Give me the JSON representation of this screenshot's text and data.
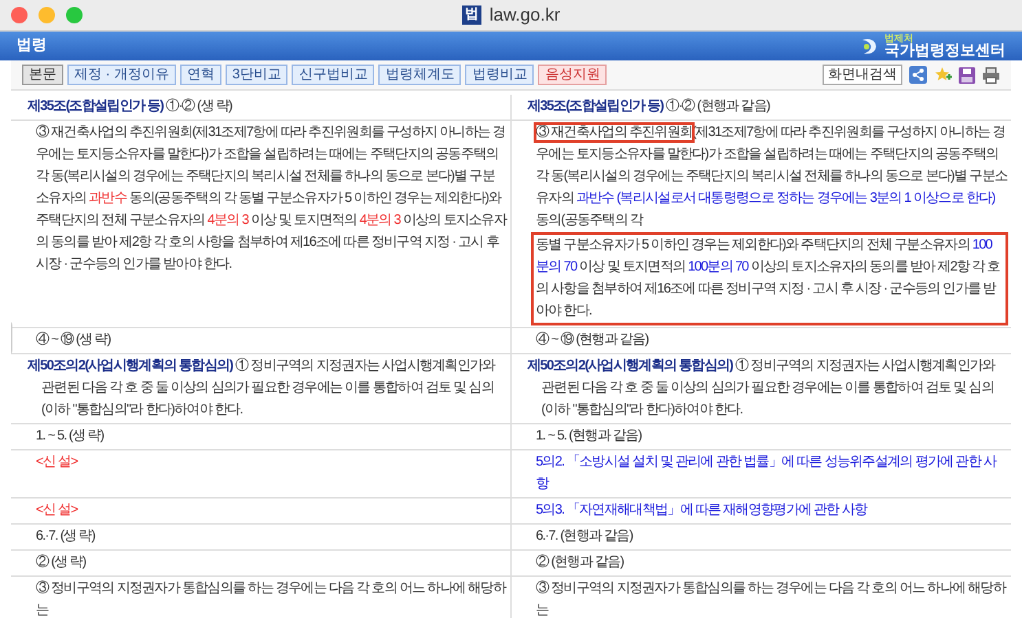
{
  "window": {
    "favicon_text": "법",
    "title": "law.go.kr"
  },
  "header": {
    "title": "법령",
    "logo_small": "법제처",
    "logo_big": "국가법령정보센터"
  },
  "toolbar": {
    "tabs": [
      {
        "label": "본문",
        "kind": "normal",
        "selected": true
      },
      {
        "label": "제정 · 개정이유",
        "kind": "normal",
        "selected": false
      },
      {
        "label": "연혁",
        "kind": "normal",
        "selected": false
      },
      {
        "label": "3단비교",
        "kind": "normal",
        "selected": false
      },
      {
        "label": "신구법비교",
        "kind": "normal",
        "selected": false
      },
      {
        "label": "법령체계도",
        "kind": "normal",
        "selected": false
      },
      {
        "label": "법령비교",
        "kind": "normal",
        "selected": false
      },
      {
        "label": "음성지원",
        "kind": "voice",
        "selected": false
      }
    ],
    "search_button": "화면내검색"
  },
  "rows": [
    {
      "left": {
        "kind": "heading",
        "blocks": [
          {
            "kind": "normal",
            "segments": [
              {
                "kind": "article",
                "text": "제35조(조합설립인가 등)"
              },
              {
                "kind": "plain",
                "text": " ①·② (생 략)"
              }
            ]
          }
        ]
      },
      "right": {
        "kind": "heading",
        "blocks": [
          {
            "kind": "normal",
            "segments": [
              {
                "kind": "article",
                "text": "제35조(조합설립인가 등)"
              },
              {
                "kind": "plain",
                "text": " ①·② (현행과 같음)"
              }
            ]
          }
        ]
      }
    },
    {
      "left": {
        "kind": "body",
        "blocks": [
          {
            "kind": "normal",
            "segments": [
              {
                "kind": "plain",
                "text": "③ 재건축사업의 추진위원회(제31조제7항에 따라 추진위원회를 구성하지 아니하는 경우에는 토지등소유자를 말한다)가 조합을 설립하려는 때에는 주택단지의 공동주택의 각 동(복리시설의 경우에는 주택단지의 복리시설 전체를 하나의 동으로 본다)별 구분소유자의 "
              },
              {
                "kind": "deleted",
                "text": "과반수"
              },
              {
                "kind": "plain",
                "text": " 동의(공동주택의 각 동별 구분소유자가 5 이하인 경우는 제외한다)와 주택단지의 전체 구분소유자의 "
              },
              {
                "kind": "deleted",
                "text": "4분의 3"
              },
              {
                "kind": "plain",
                "text": " 이상 및 토지면적의 "
              },
              {
                "kind": "deleted",
                "text": "4분의 3"
              },
              {
                "kind": "plain",
                "text": " 이상의 토지소유자의 동의를 받아 제2항 각 호의 사항을 첨부하여 제16조에 따른 정비구역 지정 · 고시 후 시장 · 군수등의 인가를 받아야 한다."
              }
            ]
          }
        ]
      },
      "right": {
        "kind": "body",
        "blocks": [
          {
            "kind": "normal",
            "segments": [
              {
                "kind": "boxed",
                "text": "③ 재건축사업의 추진위원회"
              },
              {
                "kind": "plain",
                "text": "(제31조제7항에 따라 추진위원회를 구성하지 아니하는 경우에는 토지등소유자를 말한다)가 조합을 설립하려는 때에는 주택단지의 공동주택의 각 동(복리시설의 경우에는 주택단지의 복리시설 전체를 하나의 동으로 본다)별 구분소유자의 "
              },
              {
                "kind": "added",
                "text": "과반수 (복리시설로서 대통령령으로 정하는 경우에는 3분의 1 이상으로 한다)"
              },
              {
                "kind": "plain",
                "text": " 동의(공동주택의 각"
              }
            ]
          },
          {
            "kind": "boxed",
            "segments": [
              {
                "kind": "plain",
                "text": "동별 구분소유자가 5 이하인 경우는 제외한다)와 주택단지의 전체 구분소유자의 "
              },
              {
                "kind": "added",
                "text": "100분의 70"
              },
              {
                "kind": "plain",
                "text": " 이상 및 토지면적의 "
              },
              {
                "kind": "added",
                "text": "100분의 70"
              },
              {
                "kind": "plain",
                "text": " 이상의 토지소유자의 동의를 받아 제2항 각 호의 사항을 첨부하여 제16조에 따른 정비구역 지정 · 고시 후 시장 · 군수등의 인가를 받아야 한다."
              }
            ]
          }
        ]
      }
    },
    {
      "left": {
        "kind": "body",
        "blocks": [
          {
            "kind": "normal",
            "segments": [
              {
                "kind": "plain",
                "text": "④ ~ ⑲ (생 략)"
              }
            ]
          }
        ]
      },
      "right": {
        "kind": "body",
        "blocks": [
          {
            "kind": "normal",
            "segments": [
              {
                "kind": "plain",
                "text": "④ ~ ⑲ (현행과 같음)"
              }
            ]
          }
        ]
      }
    },
    {
      "left": {
        "kind": "article",
        "blocks": [
          {
            "kind": "normal",
            "segments": [
              {
                "kind": "article",
                "text": "제50조의2(사업시행계획의 통합심의)"
              },
              {
                "kind": "plain",
                "text": " ① 정비구역의 지정권자는 사업시행계획인가와 관련된 다음 각 호 중 둘 이상의 심의가 필요한 경우에는 이를 통합하여 검토 및 심의(이하 \"통합심의\"라 한다)하여야 한다."
              }
            ]
          }
        ]
      },
      "right": {
        "kind": "article",
        "blocks": [
          {
            "kind": "normal",
            "segments": [
              {
                "kind": "article",
                "text": "제50조의2(사업시행계획의 통합심의)"
              },
              {
                "kind": "plain",
                "text": " ① 정비구역의 지정권자는 사업시행계획인가와 관련된 다음 각 호 중 둘 이상의 심의가 필요한 경우에는 이를 통합하여 검토 및 심의(이하 \"통합심의\"라 한다)하여야 한다."
              }
            ]
          }
        ]
      }
    },
    {
      "left": {
        "kind": "body",
        "blocks": [
          {
            "kind": "normal",
            "segments": [
              {
                "kind": "plain",
                "text": "1. ~ 5. (생 략)"
              }
            ]
          }
        ]
      },
      "right": {
        "kind": "body",
        "blocks": [
          {
            "kind": "normal",
            "segments": [
              {
                "kind": "plain",
                "text": "1. ~ 5. (현행과 같음)"
              }
            ]
          }
        ]
      }
    },
    {
      "left": {
        "kind": "body",
        "blocks": [
          {
            "kind": "normal",
            "segments": [
              {
                "kind": "deleted",
                "text": "<신 설>"
              }
            ]
          }
        ]
      },
      "right": {
        "kind": "body",
        "blocks": [
          {
            "kind": "normal",
            "segments": [
              {
                "kind": "added",
                "text": "5의2. 「소방시설 설치 및 관리에 관한 법률」에 따른 성능위주설계의 평가에 관한 사항"
              }
            ]
          }
        ]
      }
    },
    {
      "left": {
        "kind": "body",
        "blocks": [
          {
            "kind": "normal",
            "segments": [
              {
                "kind": "deleted",
                "text": "<신 설>"
              }
            ]
          }
        ]
      },
      "right": {
        "kind": "body",
        "blocks": [
          {
            "kind": "normal",
            "segments": [
              {
                "kind": "added",
                "text": "5의3. 「자연재해대책법」에 따른 재해영향평가에 관한 사항"
              }
            ]
          }
        ]
      }
    },
    {
      "left": {
        "kind": "body",
        "blocks": [
          {
            "kind": "normal",
            "segments": [
              {
                "kind": "plain",
                "text": "6.·7. (생 략)"
              }
            ]
          }
        ]
      },
      "right": {
        "kind": "body",
        "blocks": [
          {
            "kind": "normal",
            "segments": [
              {
                "kind": "plain",
                "text": "6.·7. (현행과 같음)"
              }
            ]
          }
        ]
      }
    },
    {
      "left": {
        "kind": "body",
        "blocks": [
          {
            "kind": "normal",
            "segments": [
              {
                "kind": "plain",
                "text": "② (생 략)"
              }
            ]
          }
        ]
      },
      "right": {
        "kind": "body",
        "blocks": [
          {
            "kind": "normal",
            "segments": [
              {
                "kind": "plain",
                "text": "② (현행과 같음)"
              }
            ]
          }
        ]
      }
    },
    {
      "left": {
        "kind": "body",
        "blocks": [
          {
            "kind": "normal",
            "segments": [
              {
                "kind": "plain",
                "text": "③ 정비구역의 지정권자가 통합심의를 하는 경우에는 다음 각 호의 어느 하나에 해당하는"
              }
            ]
          }
        ]
      },
      "right": {
        "kind": "body",
        "blocks": [
          {
            "kind": "normal",
            "segments": [
              {
                "kind": "plain",
                "text": "③ 정비구역의 지정권자가 통합심의를 하는 경우에는 다음 각 호의 어느 하나에 해당하는"
              }
            ]
          }
        ]
      }
    }
  ]
}
